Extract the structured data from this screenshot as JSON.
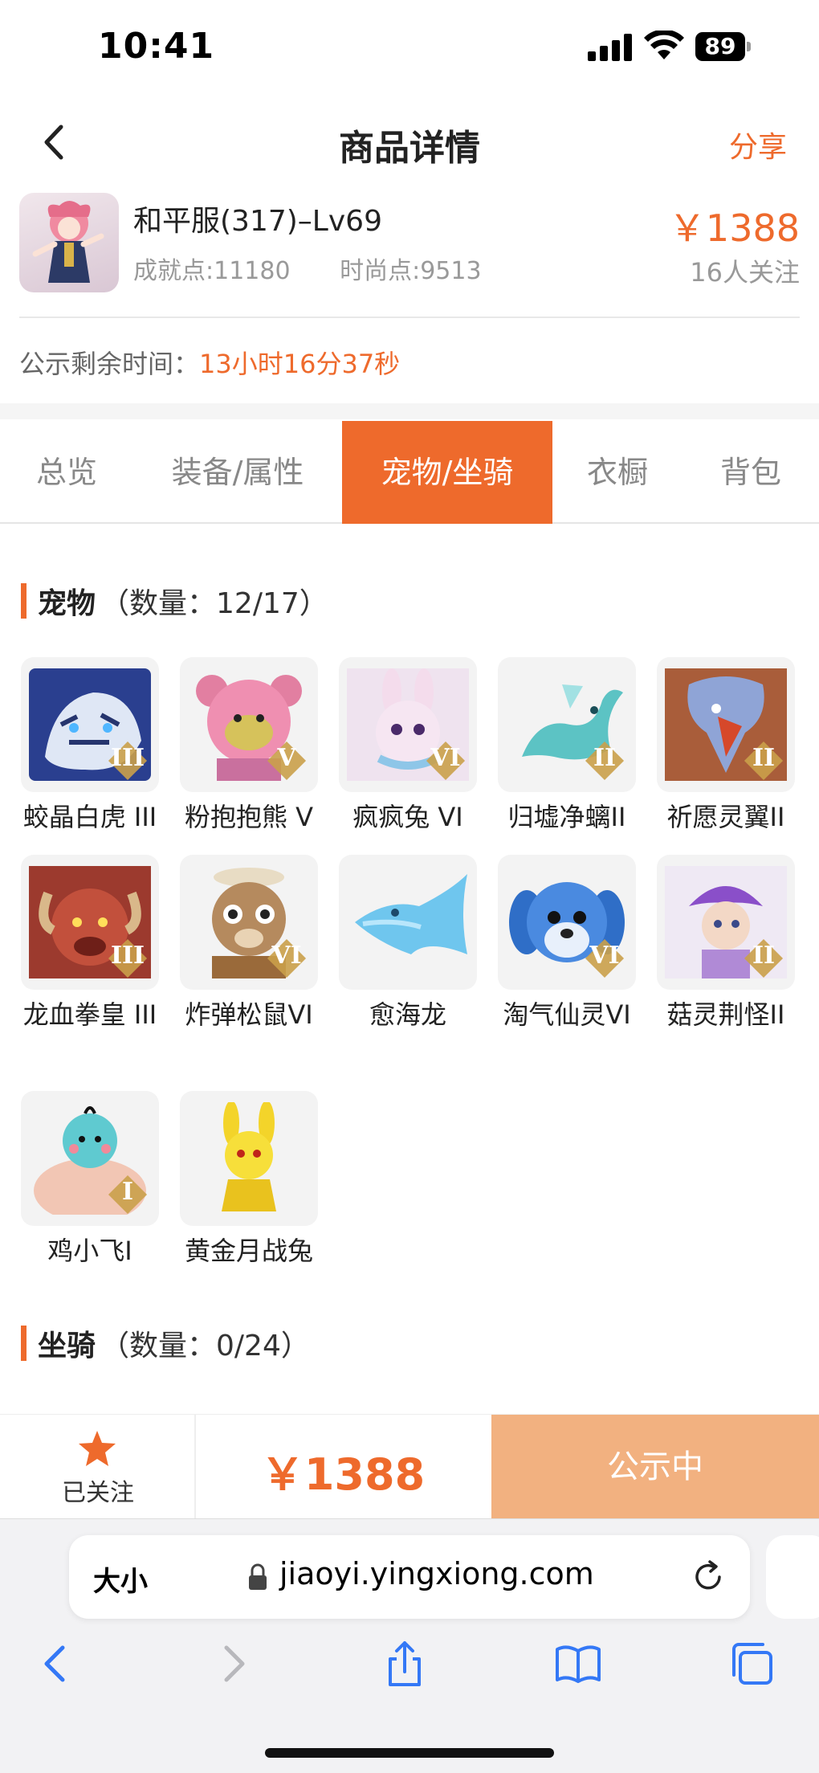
{
  "status_bar": {
    "time": "10:41",
    "battery": "89"
  },
  "header": {
    "title": "商品详情",
    "share": "分享"
  },
  "product": {
    "name": "和平服(317)–Lv69",
    "achievement": "成就点:11180",
    "fashion": "时尚点:9513",
    "price": "￥1388",
    "followers": "16人关注"
  },
  "notice": {
    "label": "公示剩余时间：",
    "remaining": "13小时16分37秒"
  },
  "tabs": [
    {
      "label": "总览"
    },
    {
      "label": "装备/属性"
    },
    {
      "label": "宠物/坐骑"
    },
    {
      "label": "衣橱"
    },
    {
      "label": "背包"
    }
  ],
  "active_tab": "宠物/坐骑",
  "pets_section": {
    "title": "宠物",
    "count": "（数量：12/17）"
  },
  "pets": [
    {
      "name": "蛟晶白虎 III",
      "rank": "III",
      "icon": "white-tiger-icon"
    },
    {
      "name": "粉抱抱熊 V",
      "rank": "V",
      "icon": "pink-bear-icon"
    },
    {
      "name": "疯疯兔 VI",
      "rank": "VI",
      "icon": "crazy-rabbit-icon"
    },
    {
      "name": "归墟净螭II",
      "rank": "II",
      "icon": "water-dragon-icon"
    },
    {
      "name": "祈愿灵翼II",
      "rank": "II",
      "icon": "spirit-bird-icon"
    },
    {
      "name": "龙血拳皇 III",
      "rank": "III",
      "icon": "dragon-boxer-icon"
    },
    {
      "name": "炸弹松鼠VI",
      "rank": "VI",
      "icon": "bomb-squirrel-icon"
    },
    {
      "name": "愈海龙",
      "rank": "",
      "icon": "sea-dragon-icon"
    },
    {
      "name": "淘气仙灵VI",
      "rank": "VI",
      "icon": "blue-puppy-icon"
    },
    {
      "name": "菇灵荆怪II",
      "rank": "II",
      "icon": "mushroom-spirit-icon"
    },
    {
      "name": "鸡小飞I",
      "rank": "I",
      "icon": "chick-icon"
    },
    {
      "name": "黄金月战兔",
      "rank": "",
      "icon": "golden-rabbit-icon"
    }
  ],
  "mounts_section": {
    "title": "坐骑",
    "count": "（数量：0/24）"
  },
  "bottom_bar": {
    "follow_label": "已关注",
    "price": "￥1388",
    "status_button": "公示中"
  },
  "browser": {
    "text_size": "大小",
    "url": "jiaoyi.yingxiong.com"
  },
  "colors": {
    "accent": "#ee6a2c",
    "button_disabled": "#f2b180",
    "link_blue": "#3478f6"
  }
}
